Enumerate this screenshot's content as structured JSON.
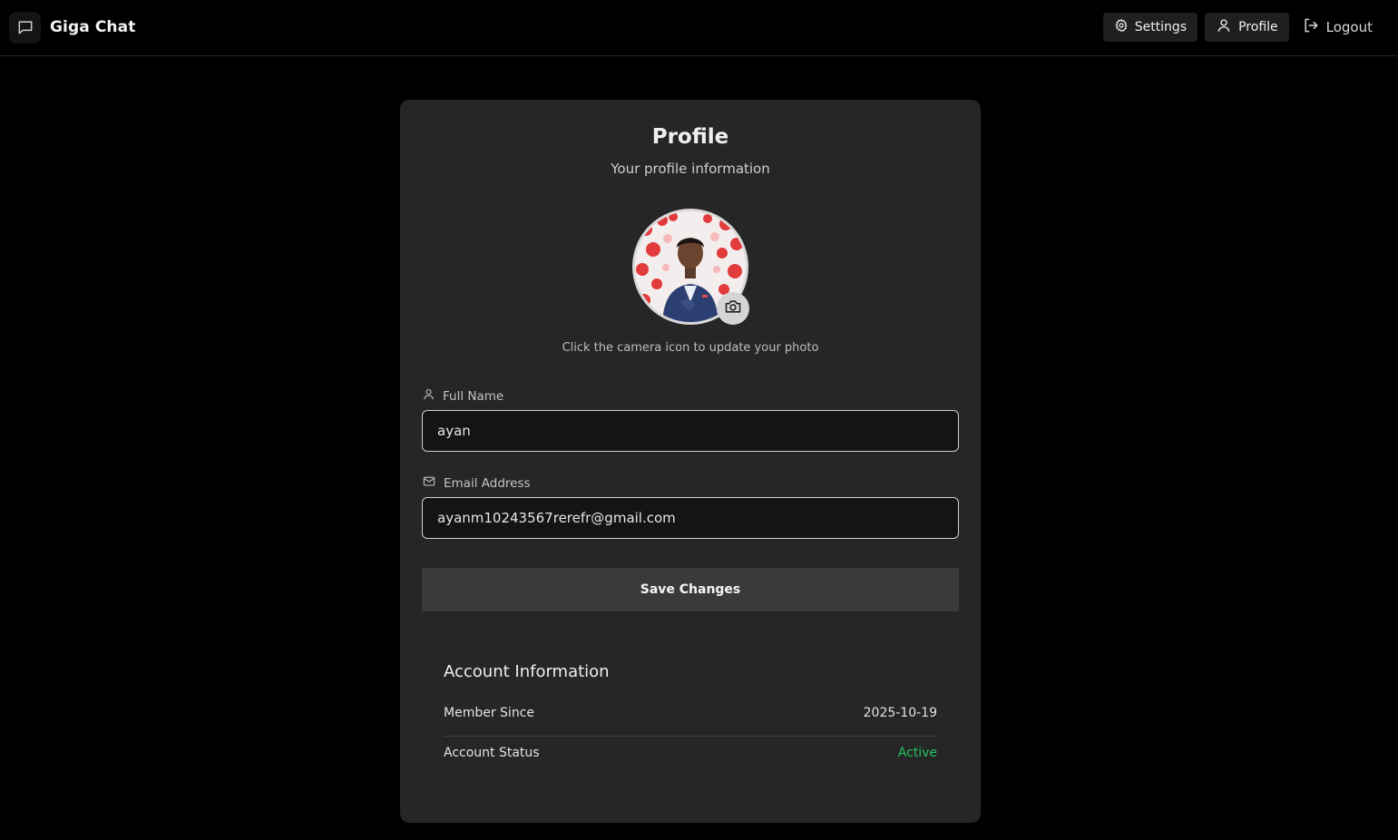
{
  "header": {
    "app_name": "Giga Chat",
    "logo_icon": "chat-bubble-icon",
    "nav": {
      "settings_label": "Settings",
      "profile_label": "Profile",
      "logout_label": "Logout"
    }
  },
  "profile": {
    "title": "Profile",
    "subtitle": "Your profile information",
    "avatar_icon": "user-photo",
    "camera_icon": "camera-icon",
    "photo_hint": "Click the camera icon to update your photo",
    "full_name": {
      "label": "Full Name",
      "value": "ayan"
    },
    "email": {
      "label": "Email Address",
      "value": "ayanm10243567rerefr@gmail.com"
    },
    "save_label": "Save Changes"
  },
  "account": {
    "title": "Account Information",
    "member_since_label": "Member Since",
    "member_since_value": "2025-10-19",
    "status_label": "Account Status",
    "status_value": "Active",
    "status_color": "#22c55e"
  }
}
